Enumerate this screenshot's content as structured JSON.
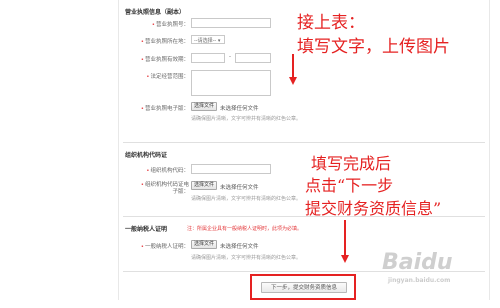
{
  "license_section": {
    "title": "营业执照信息（副本）",
    "fields": {
      "number_label": "营业执照号：",
      "location_label": "营业执照所在地：",
      "location_select": "--请选择--",
      "validity_label": "营业执照有效期：",
      "validity_sep": "-",
      "scope_label": "法定经营范围：",
      "scan_label": "营业执照电子版：",
      "choose_file": "选择文件",
      "no_file": "未选择任何文件",
      "hint": "请确保图片清晰，文字可辨并有清晰的红色公章。"
    }
  },
  "org_section": {
    "title": "组织机构代码证",
    "fields": {
      "code_label": "组织机构代码：",
      "scan_label_line1": "组织机构代码证电",
      "scan_label_line2": "子版：",
      "choose_file": "选择文件",
      "no_file": "未选择任何文件",
      "hint": "请确保图片清晰，文字可辨并有清晰的红色公章。"
    }
  },
  "taxpayer_section": {
    "title": "一般纳税人证明",
    "note": "注：所属企业具有一般纳税人证明时，此项为必填。",
    "fields": {
      "cert_label": "一般纳税人证明：",
      "choose_file": "选择文件",
      "no_file": "未选择任何文件",
      "hint": "请确保图片清晰，文字可辨并有清晰的红色公章。"
    }
  },
  "next_button": "下一步，提交财务资质信息",
  "annotations": {
    "top_line1": "接上表：",
    "top_line2": "填写文字，上传图片",
    "mid_line1": "填写完成后",
    "mid_line2": "点击“下一步",
    "mid_line3": "提交财务资质信息”"
  },
  "watermark": {
    "text": "Baidu",
    "sub": "jingyan.baidu.com"
  },
  "colors": {
    "annotation_red": "#e52222",
    "required_red": "#e4393c"
  }
}
